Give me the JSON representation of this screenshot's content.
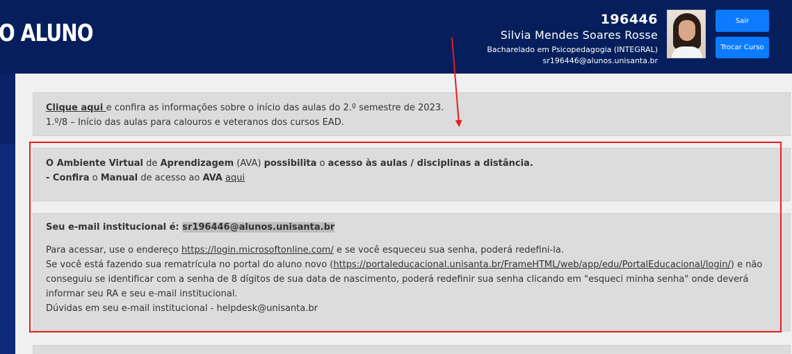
{
  "header": {
    "brand": "O ALUNO",
    "student_id": "196446",
    "student_name": "Silvia Mendes Soares Rosse",
    "course": "Bacharelado em Psicopedagogia (INTEGRAL)",
    "email": "sr196446@alunos.unisanta.br",
    "logout_label": "Sair",
    "switch_course_label": "Trocar Curso"
  },
  "notices": {
    "semester": {
      "link_text": "Clique aqui ",
      "line1_rest": "e confira as informações sobre o início das aulas do 2.º semestre de 2023.",
      "line2": "1.º/8 – Início das aulas para calouros e veteranos dos cursos EAD."
    },
    "ava": {
      "l1_b1": "O Ambiente Virtual",
      "l1_t1": " de ",
      "l1_b2": "Aprendizagem",
      "l1_t2": " (AVA) ",
      "l1_b3": "possibilita",
      "l1_t3": " o ",
      "l1_b4": "acesso às aulas / disciplinas a distância.",
      "l2_b1": "- Confira",
      "l2_t1": " o ",
      "l2_b2": "Manual",
      "l2_t2": " de acesso ao ",
      "l2_b3": "AVA",
      "l2_link": "aqui"
    },
    "email": {
      "label": "Seu e-mail institucional é: ",
      "address": "sr196446@alunos.unisanta.br",
      "access_prefix": "Para acessar, use o endereço ",
      "access_link": "https://login.microsoftonline.com/",
      "access_suffix": " e se você esqueceu sua senha, poderá redefini-la.",
      "reenroll_prefix": "Se você está fazendo sua rematrícula no portal do aluno novo (",
      "reenroll_link": "https://portaleducacional.unisanta.br/FrameHTML/web/app/edu/PortalEducacional/login/",
      "reenroll_suffix": ") e não conseguiu se identificar com a senha de 8 dígitos de sua data de nascimento, poderá redefinir sua senha clicando em \"esqueci minha senha\" onde deverá informar seu RA e seu e-mail institucional.",
      "helpdesk": "Dúvidas em seu e-mail institucional - helpdesk@unisanta.br"
    }
  },
  "annotation_color": "#ee1b1b"
}
